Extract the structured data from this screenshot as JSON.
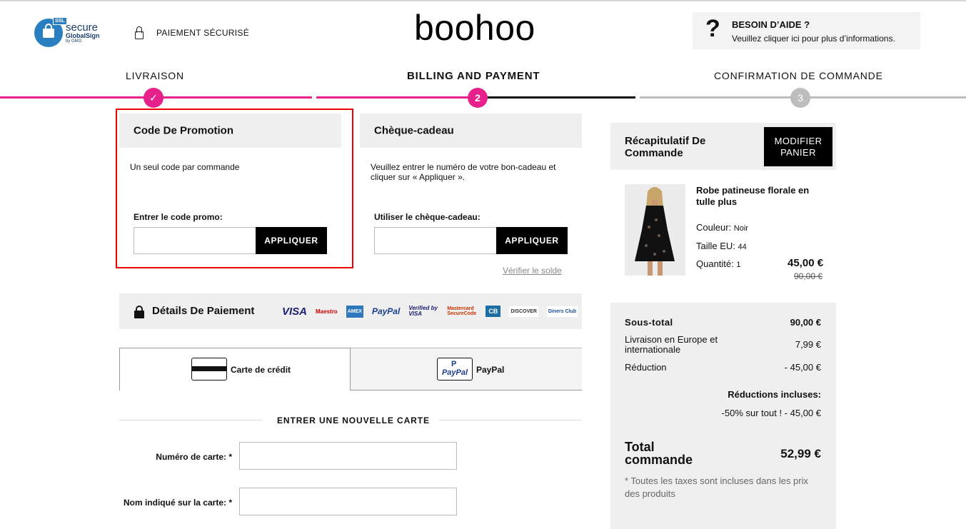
{
  "header": {
    "ssl_badge": {
      "tag": "SSL",
      "line1": "secure",
      "line2": "GlobalSign",
      "line3": "by GMO"
    },
    "secure_payment": "PAIEMENT SÉCURISÉ",
    "brand": "boohoo",
    "help": {
      "mark": "?",
      "title": "BESOIN D’AIDE ?",
      "subtitle": "Veuillez cliquer ici pour plus d’informations."
    }
  },
  "steps": [
    {
      "label": "LIVRAISON",
      "marker": "✓",
      "state": "done"
    },
    {
      "label": "BILLING AND PAYMENT",
      "marker": "2",
      "state": "active"
    },
    {
      "label": "CONFIRMATION DE COMMANDE",
      "marker": "3",
      "state": "pending"
    }
  ],
  "promo": {
    "title": "Code De Promotion",
    "note": "Un seul code par commande",
    "field_label": "Entrer le code promo:",
    "value": "",
    "button": "APPLIQUER"
  },
  "gift": {
    "title": "Chèque-cadeau",
    "note": "Veuillez entrer le numéro de votre bon-cadeau et cliquer sur « Appliquer ».",
    "field_label": "Utiliser le chèque-cadeau:",
    "value": "",
    "button": "APPLIQUER",
    "verify_link": "Vérifier le solde"
  },
  "payment": {
    "title": "Détails De Paiement",
    "card_logos": [
      "VISA",
      "Maestro",
      "AMEX",
      "PayPal",
      "Verified by VISA",
      "Mastercard SecureCode",
      "CB",
      "DISCOVER",
      "Diners Club"
    ],
    "tabs": [
      {
        "label": "Carte de crédit",
        "icon": "credit-card-icon",
        "selected": true
      },
      {
        "label": "PayPal",
        "icon": "paypal-icon",
        "selected": false
      }
    ],
    "new_card_heading": "ENTRER UNE NOUVELLE CARTE",
    "fields": [
      {
        "label": "Numéro de carte: *",
        "value": ""
      },
      {
        "label": "Nom indiqué sur la carte: *",
        "value": ""
      }
    ]
  },
  "summary": {
    "title": "Récapitulatif De Commande",
    "modify_button": "MODIFIER PANIER",
    "product": {
      "name": "Robe patineuse florale en tulle plus",
      "color_label": "Couleur:",
      "color": "Noir",
      "size_label": "Taille EU:",
      "size": "44",
      "qty_label": "Quantité:",
      "qty": "1",
      "price": "45,00 €",
      "old_price": "90,00 €"
    },
    "subtotal_label": "Sous-total",
    "subtotal": "90,00 €",
    "shipping_label": "Livraison en Europe et internationale",
    "shipping": "7,99 €",
    "discount_label": "Réduction",
    "discount": "- 45,00 €",
    "included_label": "Réductions incluses:",
    "included_line": "-50% sur tout ! - 45,00 €",
    "total_label": "Total commande",
    "total": "52,99 €",
    "tax_note": "* Toutes les taxes sont incluses dans les prix des produits"
  },
  "colors": {
    "accent": "#e6218b",
    "dark": "#000000",
    "panel": "#efefef",
    "highlight": "#e00000"
  }
}
